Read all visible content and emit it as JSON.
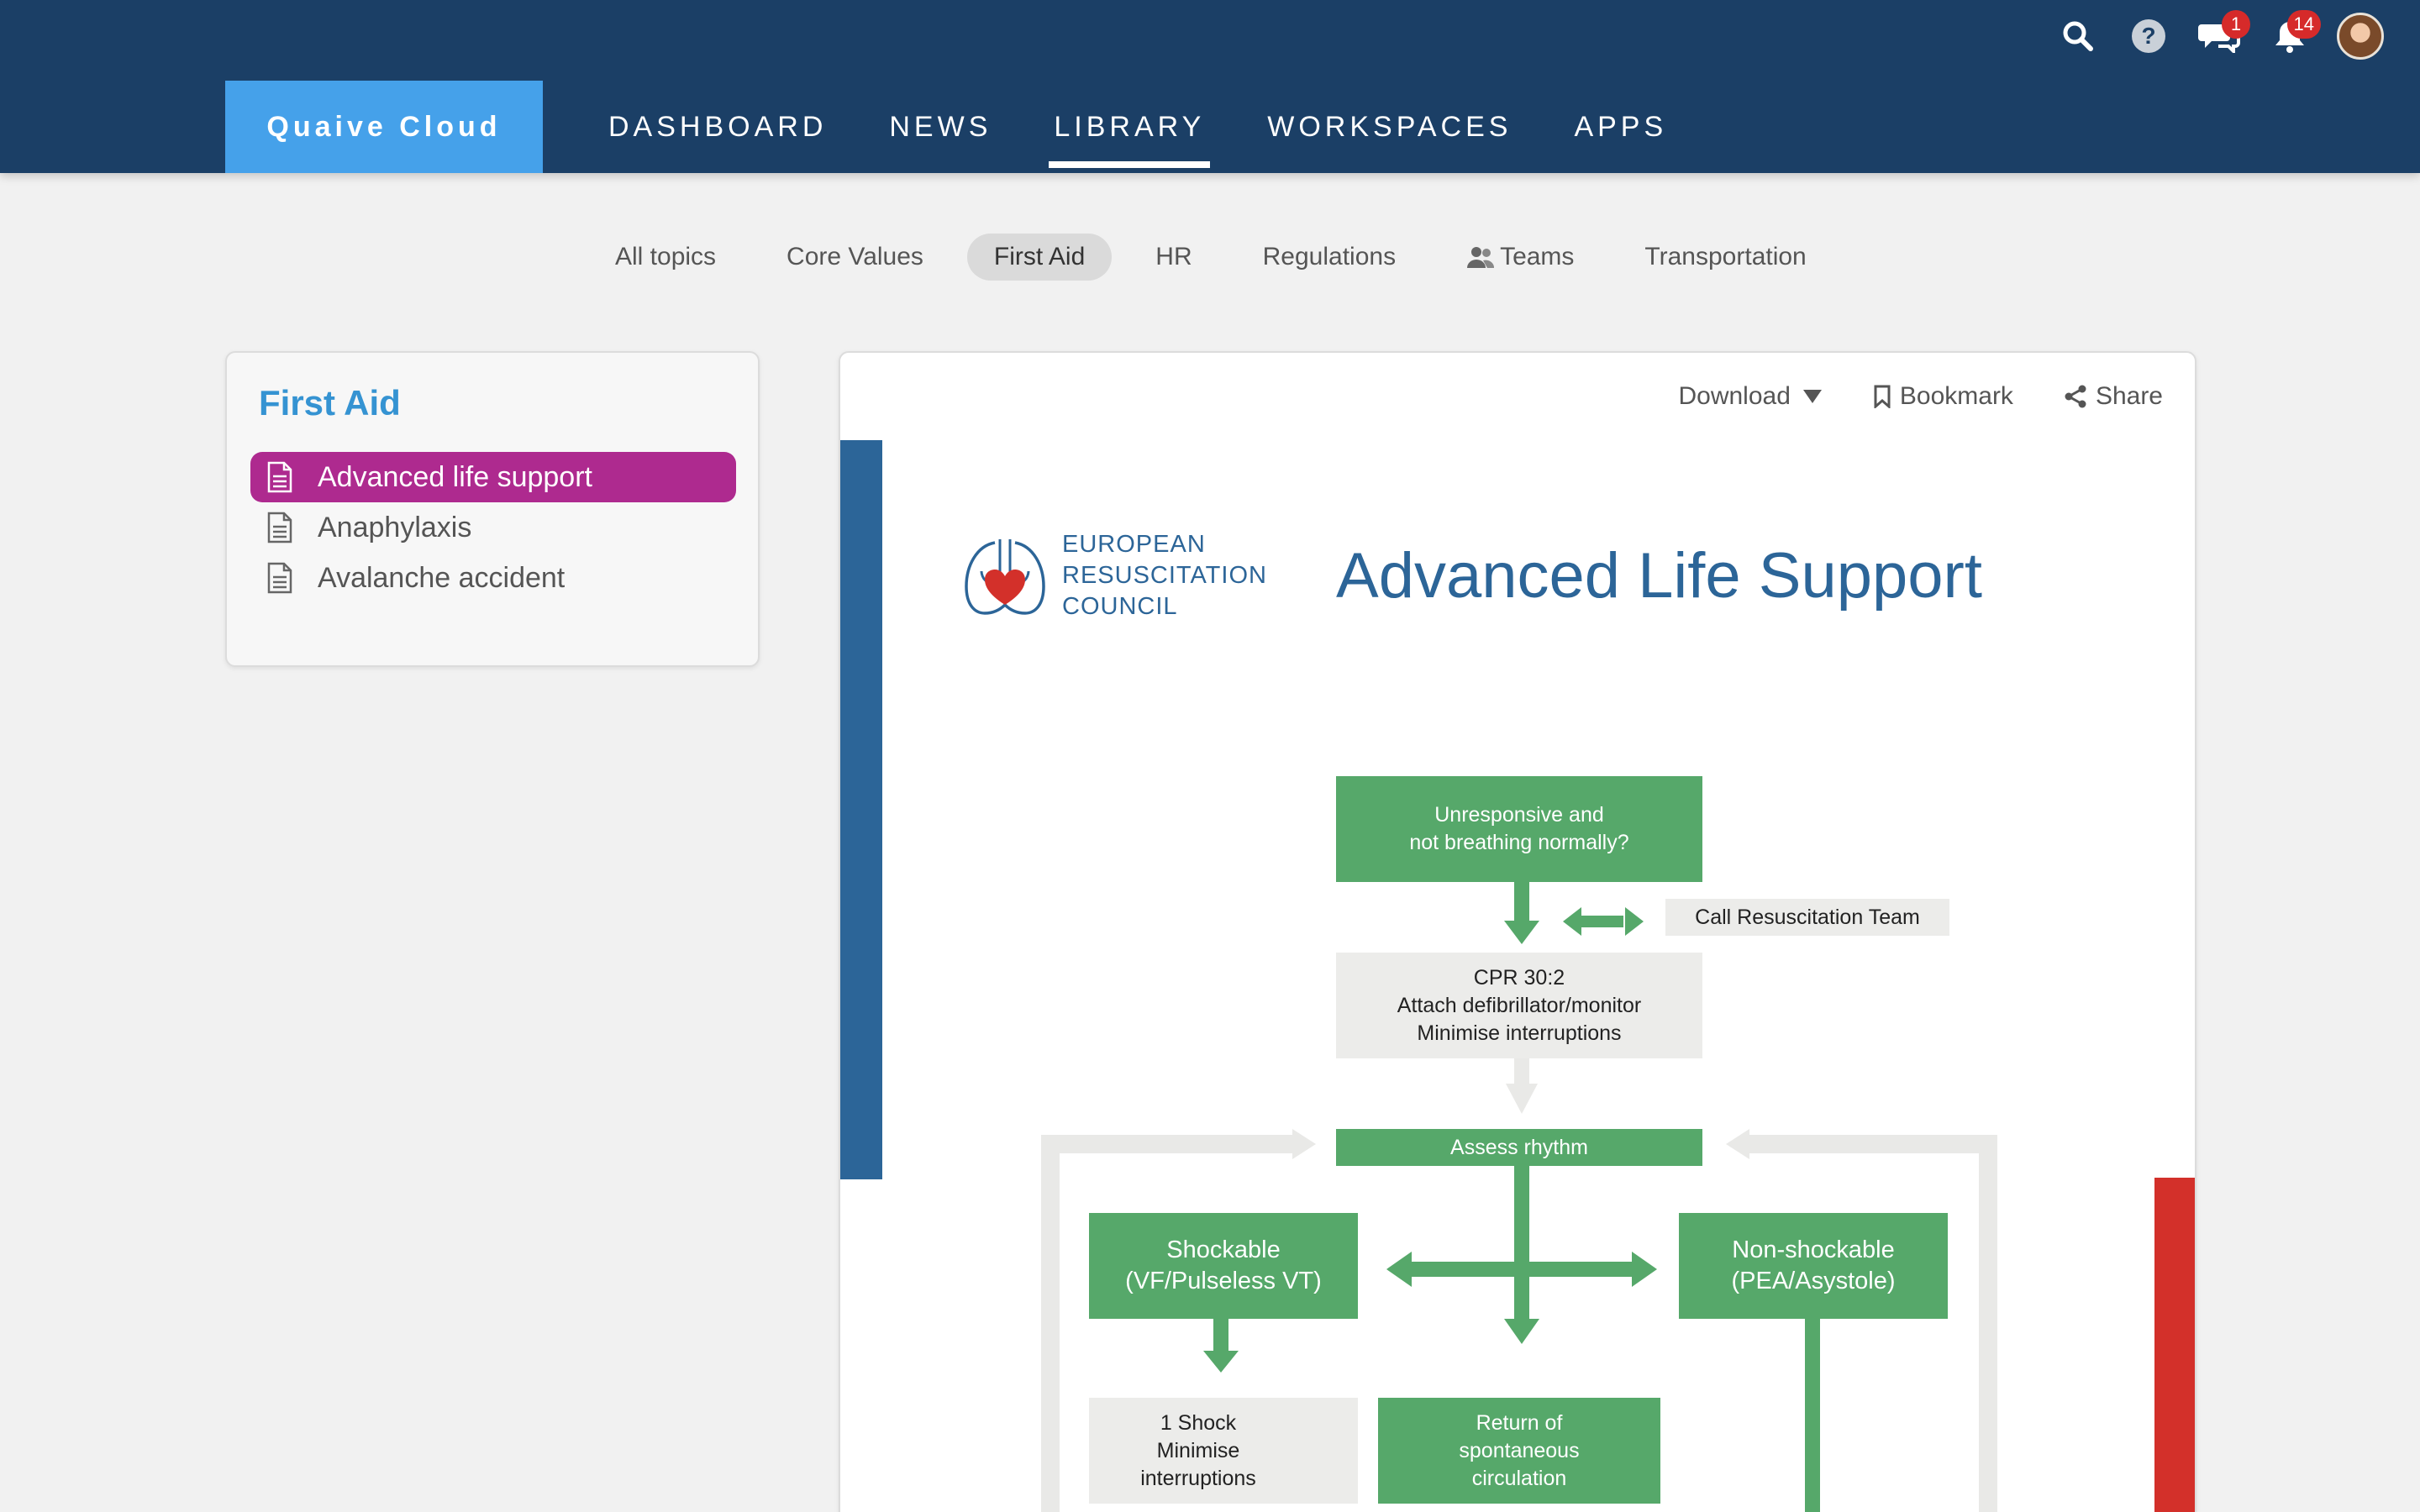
{
  "header": {
    "brand": "Quaive Cloud",
    "nav": [
      {
        "label": "DASHBOARD",
        "active": false
      },
      {
        "label": "NEWS",
        "active": false
      },
      {
        "label": "LIBRARY",
        "active": true
      },
      {
        "label": "WORKSPACES",
        "active": false
      },
      {
        "label": "APPS",
        "active": false
      }
    ],
    "icons": {
      "search": "search-icon",
      "help": "help-icon",
      "messages": "chat-icon",
      "notifications": "bell-icon",
      "avatar": "user-avatar"
    },
    "messages_badge": "1",
    "notifications_badge": "14"
  },
  "topics": [
    {
      "label": "All topics",
      "active": false
    },
    {
      "label": "Core Values",
      "active": false
    },
    {
      "label": "First Aid",
      "active": true
    },
    {
      "label": "HR",
      "active": false
    },
    {
      "label": "Regulations",
      "active": false
    },
    {
      "label": "Teams",
      "active": false,
      "icon": "users-icon"
    },
    {
      "label": "Transportation",
      "active": false
    }
  ],
  "sidebar": {
    "title": "First Aid",
    "items": [
      {
        "label": "Advanced life support",
        "active": true
      },
      {
        "label": "Anaphylaxis",
        "active": false
      },
      {
        "label": "Avalanche accident",
        "active": false
      }
    ]
  },
  "document": {
    "toolbar": {
      "download": "Download",
      "bookmark": "Bookmark",
      "share": "Share"
    },
    "org_lines": [
      "EUROPEAN",
      "RESUSCITATION",
      "COUNCIL"
    ],
    "title": "Advanced Life Support",
    "flow": {
      "unresponsive": [
        "Unresponsive and",
        "not breathing normally?"
      ],
      "call_team": "Call Resuscitation Team",
      "cpr": [
        "CPR 30:2",
        "Attach defibrillator/monitor",
        "Minimise interruptions"
      ],
      "assess": "Assess rhythm",
      "shockable": [
        "Shockable",
        "(VF/Pulseless VT)"
      ],
      "non_shockable": [
        "Non-shockable",
        "(PEA/Asystole)"
      ],
      "shock": [
        "1 Shock",
        "Minimise",
        "interruptions"
      ],
      "rosc": [
        "Return of",
        "spontaneous",
        "circulation"
      ]
    },
    "colors": {
      "flow_green": "#56a86a",
      "flow_grey": "#ececea",
      "erc_blue": "#2c6598",
      "accent_red": "#d3302a"
    }
  }
}
